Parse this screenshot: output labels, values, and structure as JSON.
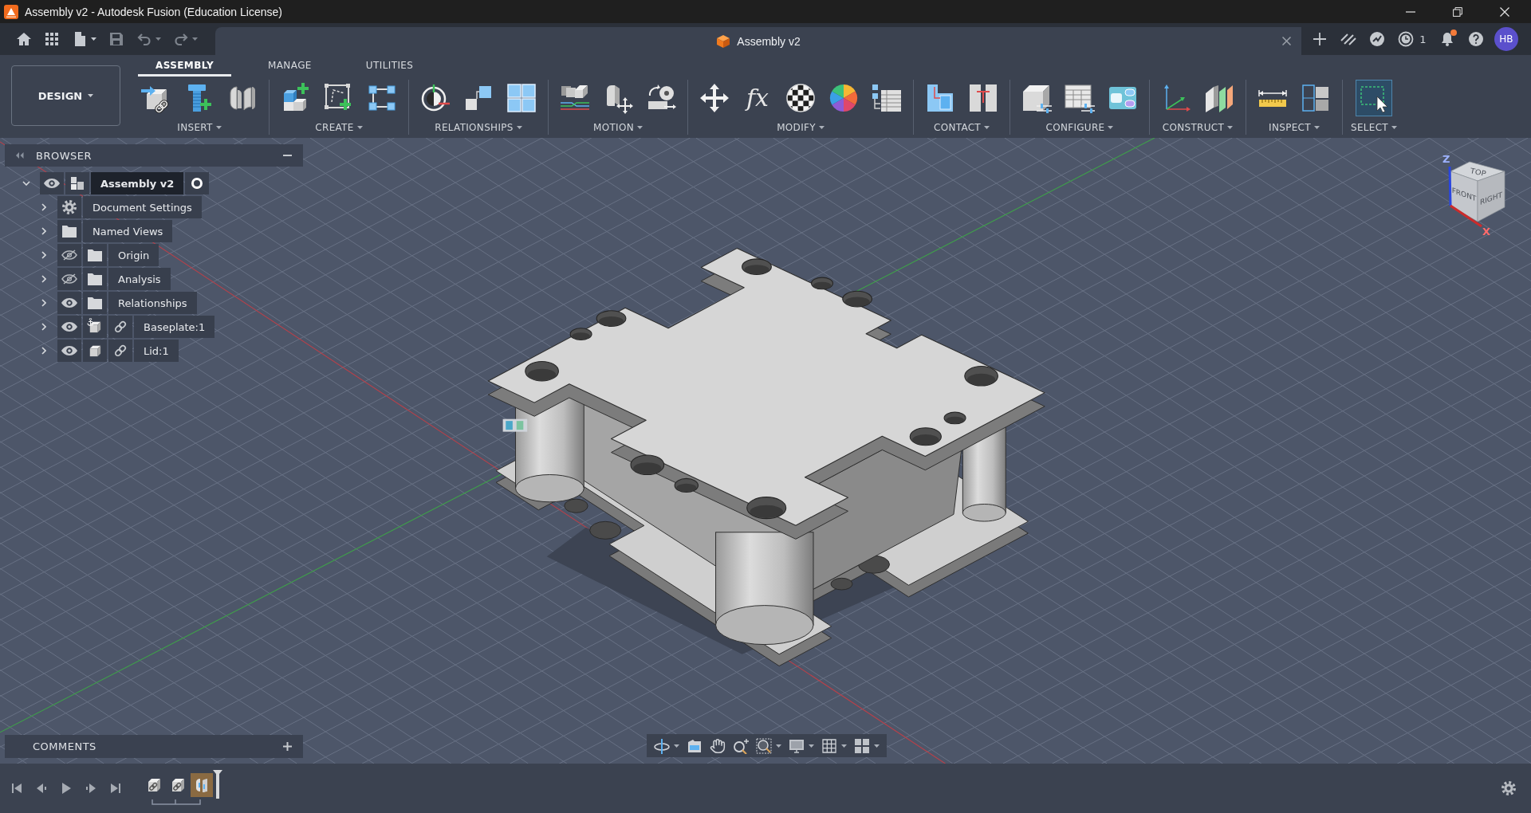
{
  "window": {
    "title": "Assembly v2 - Autodesk Fusion (Education License)"
  },
  "quick_access": [
    {
      "kind": "home",
      "disabled": false
    },
    {
      "kind": "apps",
      "disabled": false
    },
    {
      "kind": "file",
      "disabled": false
    },
    {
      "kind": "save",
      "disabled": true
    },
    {
      "kind": "undo",
      "disabled": true
    },
    {
      "kind": "redo",
      "disabled": true
    }
  ],
  "document_tab": {
    "title": "Assembly v2"
  },
  "header": {
    "job_count": "1",
    "notifications_unread": true,
    "avatar_initials": "HB"
  },
  "toolbar": {
    "workspace": "DESIGN",
    "tabs": [
      {
        "label": "ASSEMBLY",
        "selected": true
      },
      {
        "label": "MANAGE",
        "selected": false
      },
      {
        "label": "UTILITIES",
        "selected": false
      }
    ],
    "groups": [
      {
        "label": "INSERT",
        "tools": [
          {
            "selected": false
          },
          {
            "selected": false
          },
          {
            "selected": false
          }
        ]
      },
      {
        "label": "CREATE",
        "tools": [
          {
            "selected": false
          },
          {
            "selected": false
          },
          {
            "selected": false
          }
        ]
      },
      {
        "label": "RELATIONSHIPS",
        "tools": [
          {
            "selected": false
          },
          {
            "selected": false
          },
          {
            "selected": false
          }
        ]
      },
      {
        "label": "MOTION",
        "tools": [
          {
            "selected": false
          },
          {
            "selected": false
          },
          {
            "selected": false
          }
        ]
      },
      {
        "label": "MODIFY",
        "tools": [
          {
            "selected": false
          },
          {
            "selected": false,
            "glyph": "fx"
          },
          {
            "selected": false
          },
          {
            "selected": false
          },
          {
            "selected": false
          }
        ]
      },
      {
        "label": "CONTACT",
        "tools": [
          {
            "selected": false
          },
          {
            "selected": false
          }
        ]
      },
      {
        "label": "CONFIGURE",
        "tools": [
          {
            "selected": false
          },
          {
            "selected": false
          },
          {
            "selected": false
          }
        ]
      },
      {
        "label": "CONSTRUCT",
        "tools": [
          {
            "selected": false
          },
          {
            "selected": false
          }
        ]
      },
      {
        "label": "INSPECT",
        "tools": [
          {
            "selected": false
          },
          {
            "selected": false
          }
        ]
      },
      {
        "label": "SELECT",
        "tools": [
          {
            "selected": true
          }
        ]
      }
    ]
  },
  "browser": {
    "title": "BROWSER",
    "tree": {
      "label": "Assembly v2",
      "kind": "assembly",
      "expanded": true,
      "visible": true,
      "active": true,
      "children": [
        {
          "label": "Document Settings",
          "kind": "settings",
          "expanded": false
        },
        {
          "label": "Named Views",
          "kind": "folder",
          "expanded": false
        },
        {
          "label": "Origin",
          "kind": "folder",
          "expanded": false,
          "visible": false
        },
        {
          "label": "Analysis",
          "kind": "folder",
          "expanded": false,
          "visible": false
        },
        {
          "label": "Relationships",
          "kind": "folder",
          "expanded": false,
          "visible": true
        },
        {
          "label": "Baseplate:1",
          "kind": "component",
          "expanded": false,
          "visible": true,
          "grounded": true,
          "linked": true
        },
        {
          "label": "Lid:1",
          "kind": "component",
          "expanded": false,
          "visible": true,
          "grounded": false,
          "linked": true
        }
      ]
    }
  },
  "viewcube": {
    "top": "TOP",
    "front": "FRONT",
    "right": "RIGHT",
    "z_axis": "Z",
    "x_axis": "X"
  },
  "comments": {
    "title": "COMMENTS"
  },
  "timeline": {
    "items": [
      {
        "kind": "linked-part",
        "selected": false
      },
      {
        "kind": "linked-part",
        "selected": false
      },
      {
        "kind": "part-pair",
        "selected": true
      }
    ]
  }
}
